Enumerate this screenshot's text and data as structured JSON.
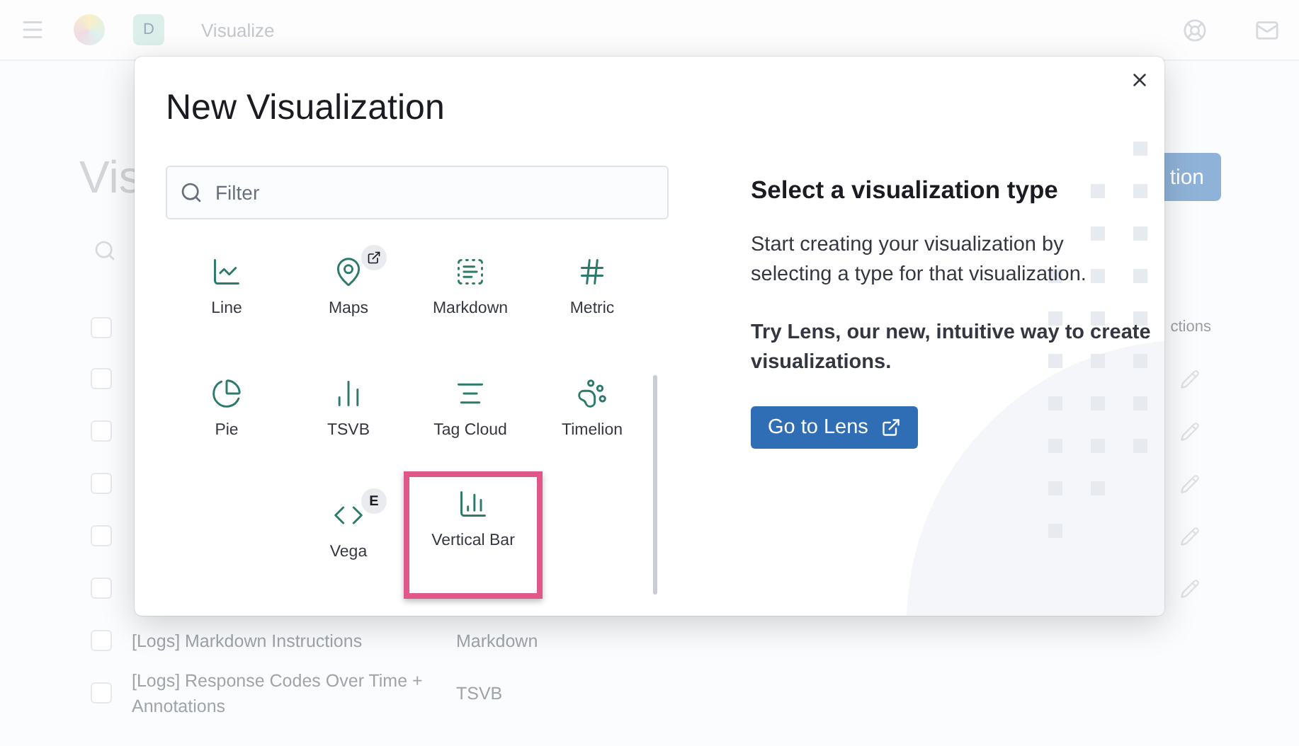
{
  "header": {
    "avatar": "D",
    "breadcrumb": "Visualize"
  },
  "page": {
    "title": "Vis",
    "create_button": "tion",
    "table_header_actions": "ctions",
    "all_checked": false,
    "rows": [
      {
        "title": "",
        "type": "",
        "editable": true,
        "checked": false
      },
      {
        "title": "",
        "type": "",
        "editable": true,
        "checked": false
      },
      {
        "title": "",
        "type": "",
        "editable": true,
        "checked": false
      },
      {
        "title": "",
        "type": "",
        "editable": true,
        "checked": false
      },
      {
        "title": "",
        "type": "",
        "editable": true,
        "checked": false
      },
      {
        "title": "[Logs] Markdown Instructions",
        "type": "Markdown",
        "editable": false,
        "checked": false
      },
      {
        "title": "[Logs] Response Codes Over Time + Annotations",
        "type": "TSVB",
        "editable": false,
        "checked": false
      }
    ]
  },
  "modal": {
    "title": "New Visualization",
    "filter": {
      "placeholder": "Filter"
    },
    "types": [
      {
        "label": "Line",
        "selected": false
      },
      {
        "label": "Maps",
        "selected": false,
        "badge": {
          "kind": "link"
        }
      },
      {
        "label": "Markdown",
        "selected": false
      },
      {
        "label": "Metric",
        "selected": false
      },
      {
        "label": "Pie",
        "selected": false
      },
      {
        "label": "TSVB",
        "selected": false
      },
      {
        "label": "Tag Cloud",
        "selected": false
      },
      {
        "label": "Timelion",
        "selected": false
      },
      {
        "label": "Vega",
        "selected": false,
        "badge": {
          "kind": "text",
          "text": "E"
        }
      },
      {
        "label": "Vertical Bar",
        "selected": true
      }
    ],
    "info": {
      "heading": "Select a visualization type",
      "text": "Start creating your visualization by selecting a type for that visualization.",
      "lens_text": "Try Lens, our new, intuitive way to create visualizations.",
      "lens_button": "Go to Lens"
    }
  }
}
